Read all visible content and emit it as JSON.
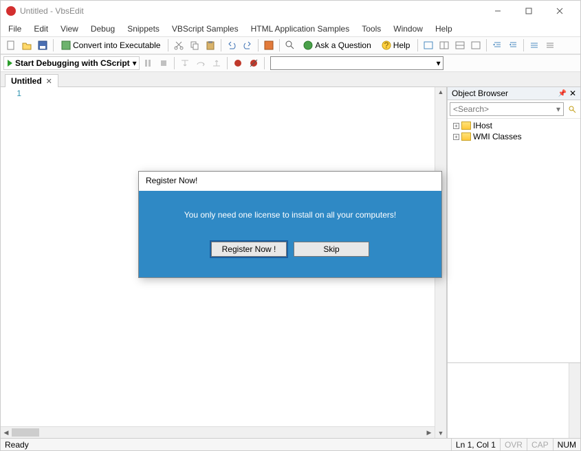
{
  "window": {
    "title": "Untitled - VbsEdit"
  },
  "menu": [
    "File",
    "Edit",
    "View",
    "Debug",
    "Snippets",
    "VBScript Samples",
    "HTML Application Samples",
    "Tools",
    "Window",
    "Help"
  ],
  "toolbar1": {
    "convert": "Convert into Executable",
    "ask": "Ask a Question",
    "help": "Help"
  },
  "toolbar2": {
    "debug_label": "Start Debugging with CScript"
  },
  "tabs": [
    {
      "label": "Untitled"
    }
  ],
  "editor": {
    "line_number": "1"
  },
  "object_browser": {
    "title": "Object Browser",
    "search_placeholder": "<Search>",
    "nodes": [
      "IHost",
      "WMI Classes"
    ]
  },
  "status": {
    "ready": "Ready",
    "pos": "Ln 1, Col 1",
    "ovr": "OVR",
    "cap": "CAP",
    "num": "NUM"
  },
  "modal": {
    "title": "Register Now!",
    "message": "You only need one license to install on all your computers!",
    "register_btn": "Register Now !",
    "skip_btn": "Skip"
  }
}
